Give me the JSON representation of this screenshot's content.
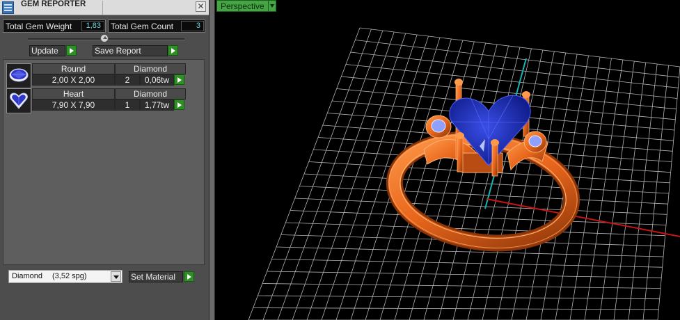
{
  "window": {
    "title": "GEM REPORTER",
    "close_icon": "close-icon"
  },
  "stats": {
    "total_weight_label": "Total Gem Weight",
    "total_weight_value": "1,83",
    "total_count_label": "Total Gem Count",
    "total_count_value": "3"
  },
  "toolbar": {
    "update_label": "Update",
    "save_report_label": "Save Report"
  },
  "gems": [
    {
      "shape": "Round",
      "material": "Diamond",
      "size": "2,00 X 2,00",
      "count": "2",
      "weight": "0,06tw",
      "icon": "round-gem-icon"
    },
    {
      "shape": "Heart",
      "material": "Diamond",
      "size": "7,90 X 7,90",
      "count": "1",
      "weight": "1,77tw",
      "icon": "heart-gem-icon"
    }
  ],
  "material_select": {
    "name": "Diamond",
    "sg": "(3,52 spg)"
  },
  "set_material_label": "Set Material",
  "viewport": {
    "view_label": "Perspective"
  },
  "colors": {
    "metal": "#e8661c",
    "gem": "#1c2fb0",
    "grid": "#b4b4b4",
    "axis_y": "#18b4b4",
    "axis_x": "#c81414",
    "go_button": "#2f8f26"
  }
}
